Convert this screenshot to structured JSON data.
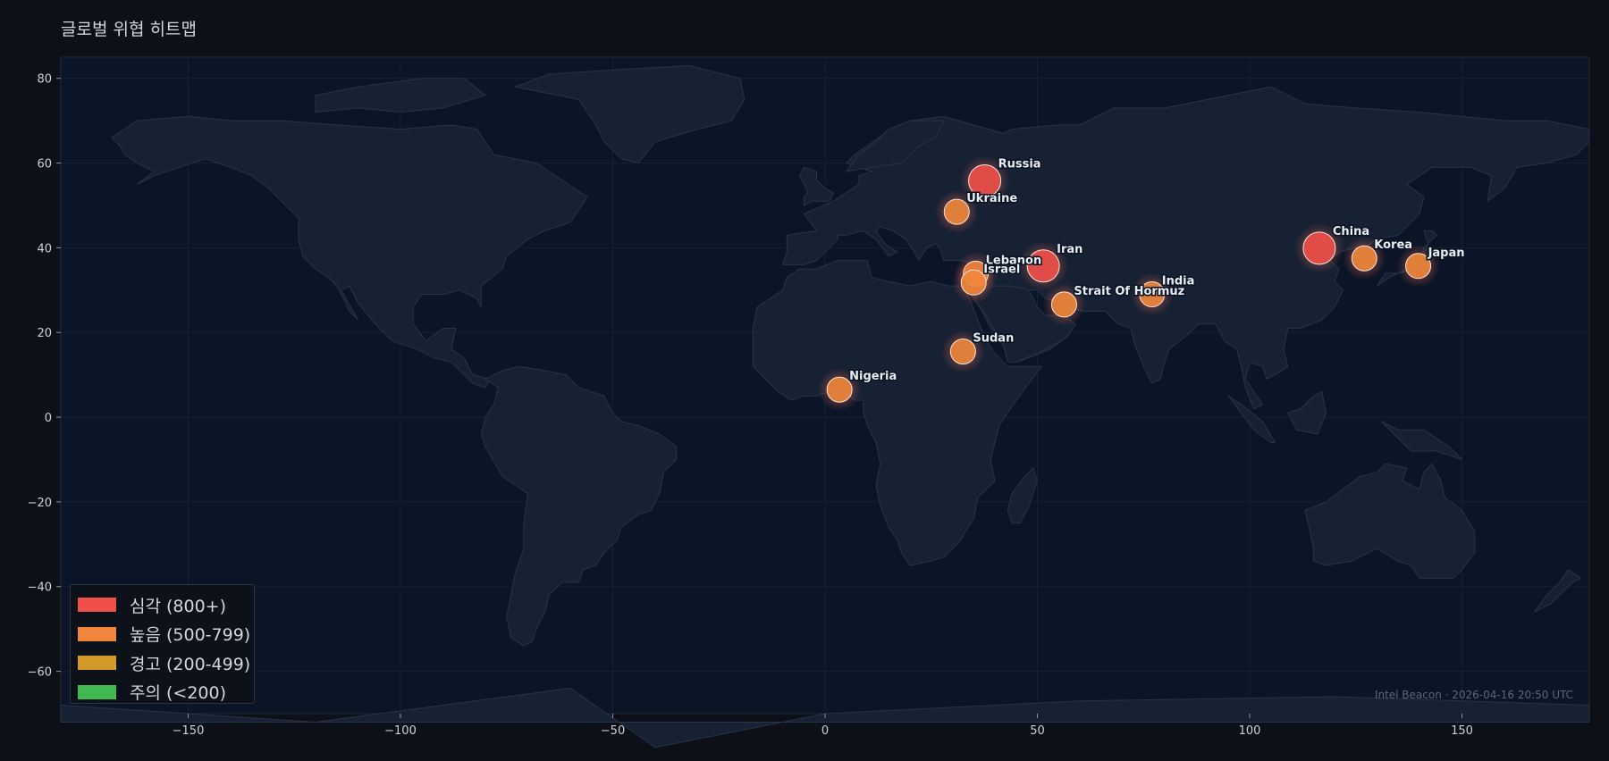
{
  "title": "글로벌 위협 히트맵",
  "footer": "Intel Beacon · 2026-04-16 20:50 UTC",
  "legend": [
    {
      "label": "심각 (800+)",
      "color": "#f0504a"
    },
    {
      "label": "높음 (500-799)",
      "color": "#f0873c"
    },
    {
      "label": "경고 (200-499)",
      "color": "#d39a2a"
    },
    {
      "label": "주의 (<200)",
      "color": "#3fb950"
    }
  ],
  "chart_data": {
    "type": "scatter",
    "title": "글로벌 위협 히트맵",
    "xlim": [
      -180,
      180
    ],
    "ylim": [
      -70,
      85
    ],
    "xticks": [
      -150,
      -100,
      -50,
      0,
      50,
      100,
      150
    ],
    "yticks": [
      -60,
      -40,
      -20,
      0,
      20,
      40,
      60,
      80
    ],
    "xtick_labels": [
      "−150",
      "−100",
      "−50",
      "0",
      "50",
      "100",
      "150"
    ],
    "ytick_labels": [
      "−60",
      "−40",
      "−20",
      "0",
      "20",
      "40",
      "60",
      "80"
    ],
    "grid": true,
    "legend_position": "bottom-left",
    "points": [
      {
        "name": "Russia",
        "lon": 37.6,
        "lat": 55.8,
        "level": "심각"
      },
      {
        "name": "Ukraine",
        "lon": 31.0,
        "lat": 48.5,
        "level": "높음"
      },
      {
        "name": "Iran",
        "lon": 51.4,
        "lat": 35.7,
        "level": "심각"
      },
      {
        "name": "Lebanon",
        "lon": 35.5,
        "lat": 33.9,
        "level": "높음"
      },
      {
        "name": "Israel",
        "lon": 35.0,
        "lat": 31.8,
        "level": "높음"
      },
      {
        "name": "India",
        "lon": 77.0,
        "lat": 29.0,
        "level": "높음"
      },
      {
        "name": "Strait Of Hormuz",
        "lon": 56.3,
        "lat": 26.6,
        "level": "높음"
      },
      {
        "name": "Sudan",
        "lon": 32.5,
        "lat": 15.5,
        "level": "높음"
      },
      {
        "name": "Nigeria",
        "lon": 3.4,
        "lat": 6.5,
        "level": "높음"
      },
      {
        "name": "China",
        "lon": 116.4,
        "lat": 39.9,
        "level": "심각"
      },
      {
        "name": "Korea",
        "lon": 127.0,
        "lat": 37.5,
        "level": "높음"
      },
      {
        "name": "Japan",
        "lon": 139.7,
        "lat": 35.7,
        "level": "높음"
      }
    ]
  }
}
